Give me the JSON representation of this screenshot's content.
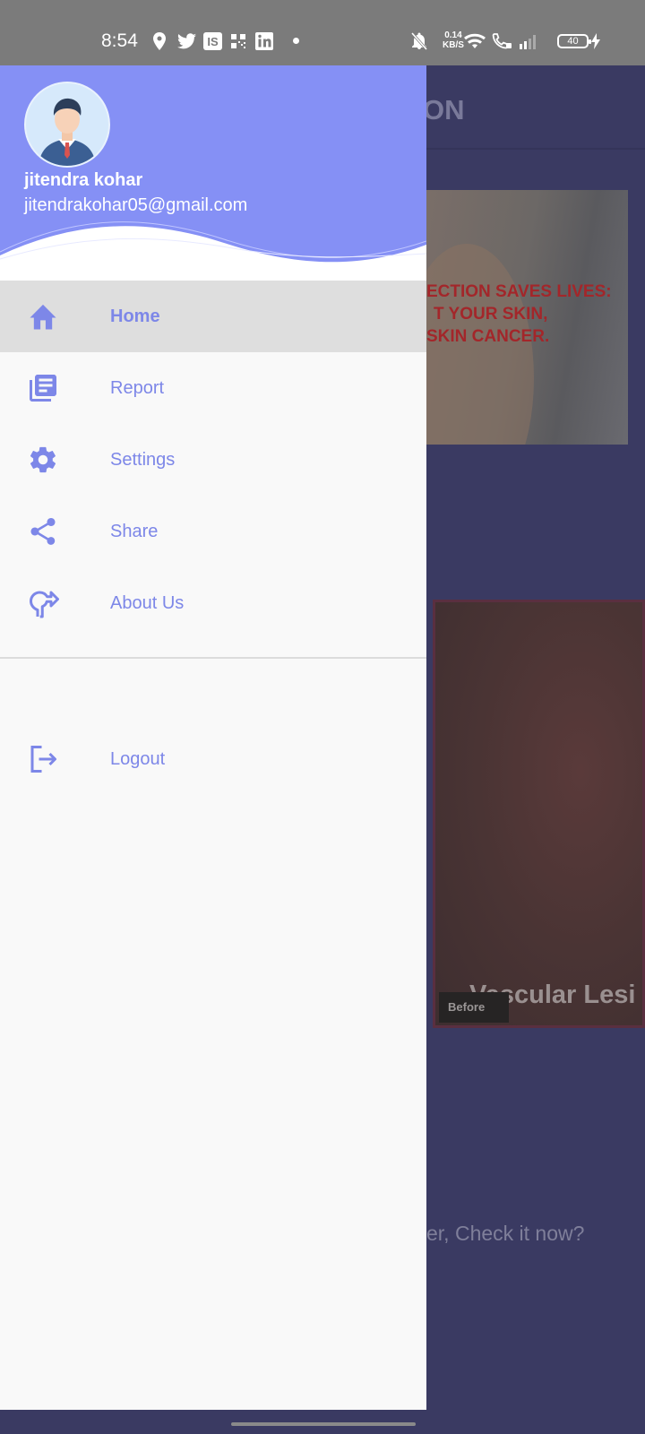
{
  "status_bar": {
    "time": "8:54",
    "notification_icons": [
      "location-pin-icon",
      "twitter-icon",
      "is-app-icon",
      "qr-code-icon",
      "linkedin-icon",
      "more-dot-icon"
    ],
    "network_speed_value": "0.14",
    "network_speed_unit": "KB/S",
    "battery_level": "40",
    "system_icons": [
      "mute-icon",
      "wifi-icon",
      "wifi-calling-icon",
      "signal-icon",
      "battery-icon",
      "charging-icon"
    ]
  },
  "background_screen": {
    "title_fragment": "ON",
    "banner_text_lines": [
      "ECTION SAVES LIVES:",
      "T YOUR SKIN,",
      "SKIN CANCER."
    ],
    "lesion_label": "Vascular Lesi",
    "before_tag": "Before",
    "cta_text": "er, Check it now?"
  },
  "drawer": {
    "user": {
      "name": "jitendra kohar",
      "email": "jitendrakohar05@gmail.com"
    },
    "items": [
      {
        "label": "Home",
        "icon": "home-icon",
        "active": true
      },
      {
        "label": "Report",
        "icon": "report-icon",
        "active": false
      },
      {
        "label": "Settings",
        "icon": "gear-icon",
        "active": false
      },
      {
        "label": "Share",
        "icon": "share-icon",
        "active": false
      },
      {
        "label": "About Us",
        "icon": "about-icon",
        "active": false
      }
    ],
    "logout": {
      "label": "Logout",
      "icon": "logout-icon"
    }
  },
  "colors": {
    "header": "#8590f5",
    "accent": "#7d87e8",
    "active_row": "#dedede",
    "scrim_background": "#3a3a62"
  }
}
